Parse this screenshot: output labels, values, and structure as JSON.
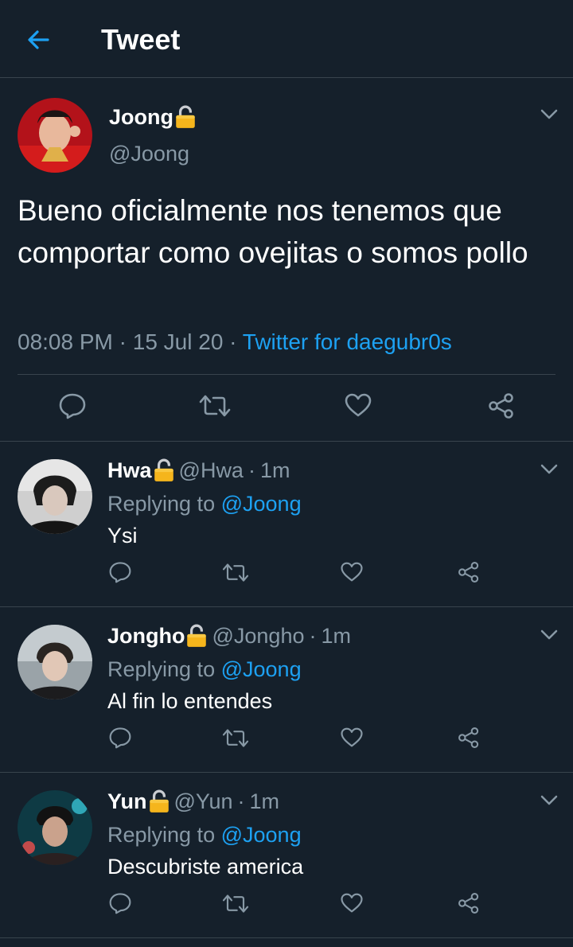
{
  "header": {
    "title": "Tweet",
    "back_icon": "arrow-left-icon"
  },
  "main_tweet": {
    "name": "Joong",
    "handle": "@Joong",
    "text": "Bueno oficialmente nos tenemos que comportar como ovejitas o somos pollo",
    "time": "08:08 PM",
    "date": "15 Jul 20",
    "source": "Twitter for daegubr0s",
    "separator": "·"
  },
  "replies": [
    {
      "name": "Hwa",
      "handle": "@Hwa",
      "time": "1m",
      "replying_prefix": "Replying to",
      "replying_to": "@Joong",
      "text": "Ysi"
    },
    {
      "name": "Jongho",
      "handle": "@Jongho",
      "time": "1m",
      "replying_prefix": "Replying to",
      "replying_to": "@Joong",
      "text": "Al fin lo entendes"
    },
    {
      "name": "Yun",
      "handle": "@Yun",
      "time": "1m",
      "replying_prefix": "Replying to",
      "replying_to": "@Joong",
      "text": "Descubriste america"
    }
  ],
  "icons": [
    "arrow-left-icon",
    "lock-icon",
    "chevron-down-icon",
    "reply-icon",
    "retweet-icon",
    "like-icon",
    "share-icon"
  ],
  "colors": {
    "background": "#15202b",
    "accent": "#1da1f2",
    "muted": "#8899a6",
    "divider": "#38444d",
    "lock": "#f5b51c"
  }
}
